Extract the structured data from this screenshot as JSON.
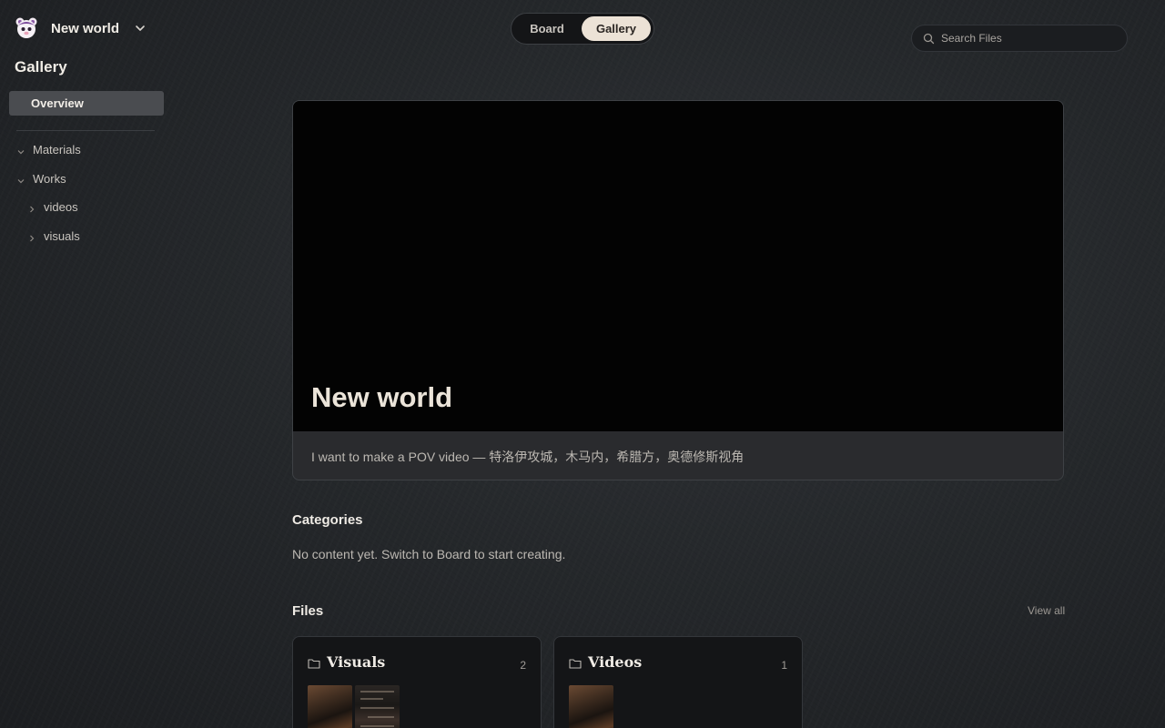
{
  "workspace": {
    "name": "New world"
  },
  "sidebar": {
    "title": "Gallery",
    "overview_label": "Overview",
    "tree": [
      {
        "label": "Materials",
        "state": "expanded"
      },
      {
        "label": "Works",
        "state": "expanded"
      },
      {
        "label": "videos",
        "state": "collapsed"
      },
      {
        "label": "visuals",
        "state": "collapsed"
      }
    ]
  },
  "view_toggle": {
    "board_label": "Board",
    "gallery_label": "Gallery",
    "active": "Gallery"
  },
  "search": {
    "placeholder": "Search Files"
  },
  "hero": {
    "title": "New world",
    "description": "I want to make a POV video — 特洛伊攻城，木马内，希腊方，奥德修斯视角"
  },
  "categories": {
    "title": "Categories",
    "empty_text": "No content yet. Switch to Board to start creating."
  },
  "files": {
    "title": "Files",
    "view_all_label": "View all",
    "folders": [
      {
        "name": "Visuals",
        "count": "2"
      },
      {
        "name": "Videos",
        "count": "1"
      }
    ]
  },
  "colors": {
    "background": "#25282b",
    "toggle_active": "#ece2d6",
    "hero_media": "#030303"
  }
}
